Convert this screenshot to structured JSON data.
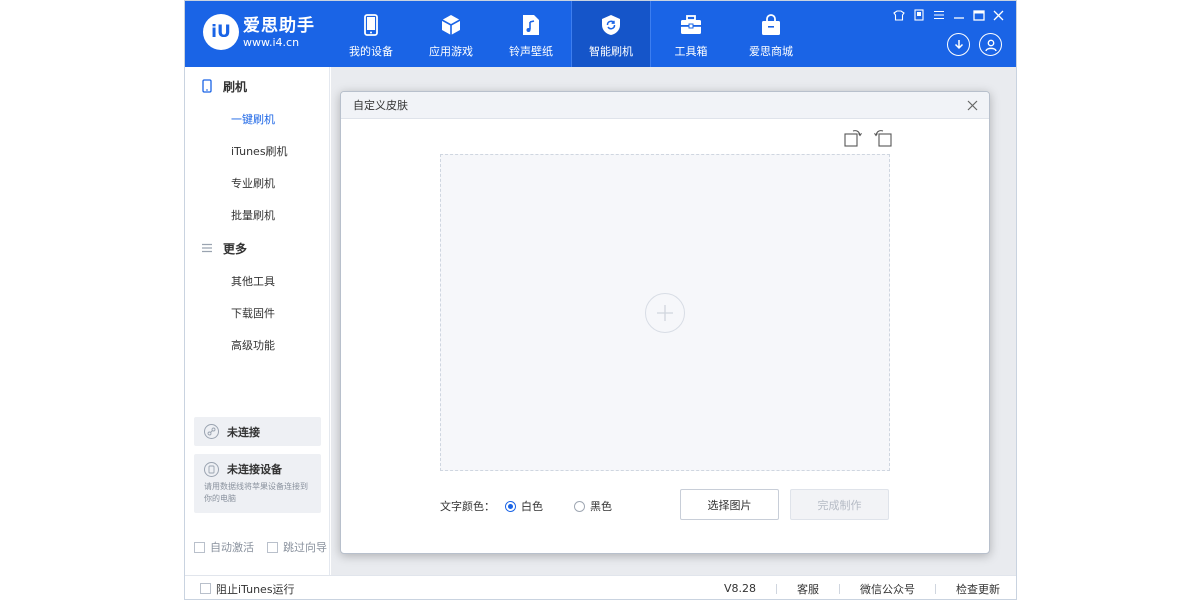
{
  "app": {
    "logo_mark": "iU",
    "name": "爱思助手",
    "url": "www.i4.cn"
  },
  "nav": [
    {
      "label": "我的设备",
      "icon": "phone-icon"
    },
    {
      "label": "应用游戏",
      "icon": "cube-icon"
    },
    {
      "label": "铃声壁纸",
      "icon": "music-file-icon"
    },
    {
      "label": "智能刷机",
      "icon": "refresh-shield-icon",
      "active": true
    },
    {
      "label": "工具箱",
      "icon": "toolbox-icon"
    },
    {
      "label": "爱思商城",
      "icon": "shopping-bag-icon"
    }
  ],
  "sidebar": {
    "section1": {
      "title": "刷机",
      "icon": "phone-outline-icon"
    },
    "items1": [
      "一键刷机",
      "iTunes刷机",
      "专业刷机",
      "批量刷机"
    ],
    "section2": {
      "title": "更多",
      "icon": "menu-lines-icon"
    },
    "items2": [
      "其他工具",
      "下载固件",
      "高级功能"
    ],
    "conn_status": "未连接",
    "device_status": "未连接设备",
    "device_hint": "请用数据线将苹果设备连接到你的电脑",
    "check_auto_activate": "自动激活",
    "check_skip_guide": "跳过向导"
  },
  "footer": {
    "block_itunes": "阻止iTunes运行",
    "version": "V8.28",
    "service": "客服",
    "wechat": "微信公众号",
    "update": "检查更新"
  },
  "dialog": {
    "title": "自定义皮肤",
    "text_color_label": "文字颜色：",
    "option_white": "白色",
    "option_black": "黑色",
    "selected": "白色",
    "choose_image": "选择图片",
    "finish": "完成制作"
  },
  "colors": {
    "brand": "#1a64e6",
    "nav_active": "#1555c9"
  }
}
